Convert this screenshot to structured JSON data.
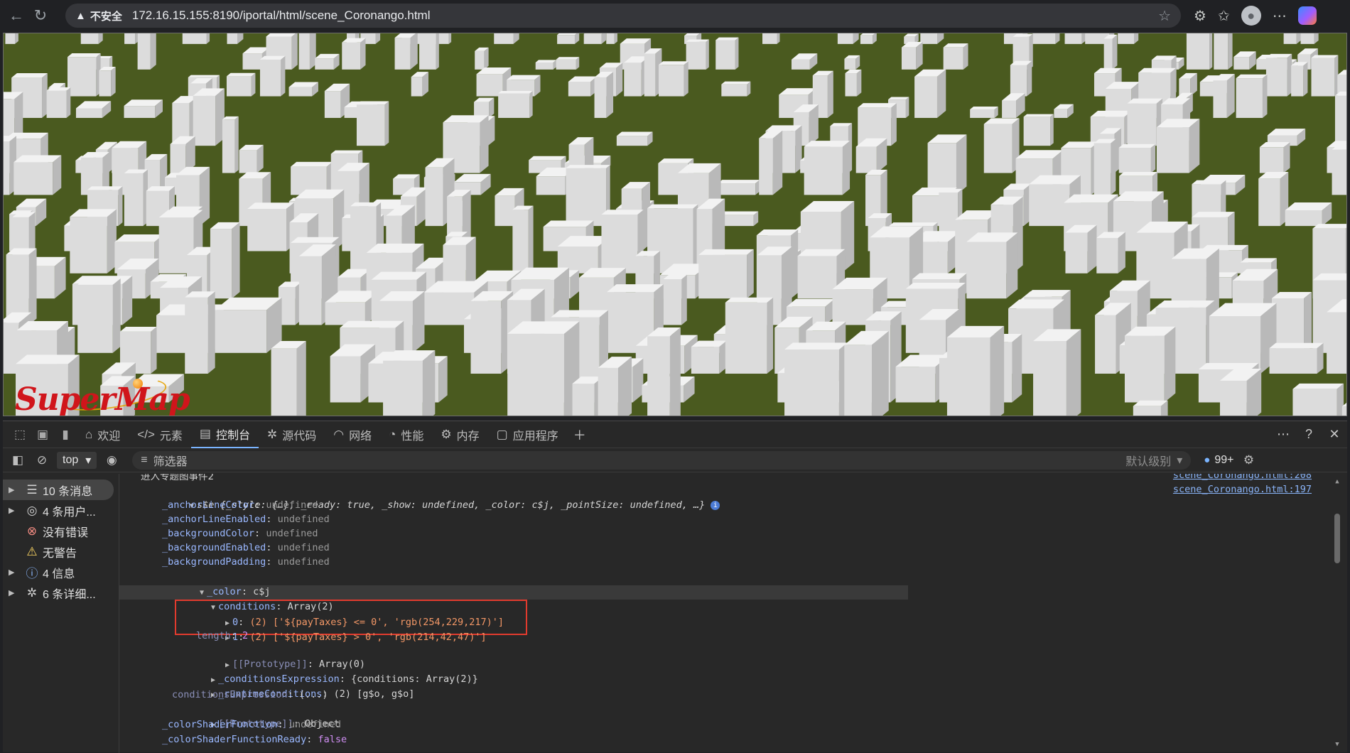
{
  "browser": {
    "security_label": "不安全",
    "url": "172.16.15.155:8190/iportal/html/scene_Coronango.html"
  },
  "scene": {
    "logo_text": "SuperMap",
    "ground_color": "#4a5a1f",
    "building_color": "#e6e6e6"
  },
  "devtools": {
    "tabs": [
      {
        "label": "欢迎",
        "icon": "home-icon"
      },
      {
        "label": "元素",
        "icon": "code-icon"
      },
      {
        "label": "控制台",
        "icon": "console-icon",
        "active": true
      },
      {
        "label": "源代码",
        "icon": "bug-icon"
      },
      {
        "label": "网络",
        "icon": "wifi-icon"
      },
      {
        "label": "性能",
        "icon": "gauge-icon"
      },
      {
        "label": "内存",
        "icon": "memory-icon"
      },
      {
        "label": "应用程序",
        "icon": "app-icon"
      }
    ],
    "toolbar": {
      "context": "top",
      "filter_placeholder": "筛选器",
      "level": "默认级别",
      "issues_count": "99+"
    },
    "sidebar": [
      {
        "label": "10 条消息",
        "icon": "list-icon",
        "expandable": true,
        "selected": true
      },
      {
        "label": "4 条用户...",
        "icon": "user-icon",
        "expandable": true
      },
      {
        "label": "没有错误",
        "icon": "error-icon",
        "expandable": false
      },
      {
        "label": "无警告",
        "icon": "warning-icon",
        "expandable": false
      },
      {
        "label": "4 信息",
        "icon": "info-icon",
        "expandable": true
      },
      {
        "label": "6 条详细...",
        "icon": "bug-icon",
        "expandable": true
      }
    ],
    "console": {
      "top_cut_text": "进入专题图事件2",
      "source_prev": "scene_Coronango.html:208",
      "source_main": "scene_Coronango.html:197",
      "object_head": {
        "name": "s$e",
        "preview": "{_style: {…}, _ready: true, _show: undefined, _color: c$j, _pointSize: undefined, …}"
      },
      "props": [
        {
          "key": "_anchorLineColor",
          "value": "undefined"
        },
        {
          "key": "_anchorLineEnabled",
          "value": "undefined"
        },
        {
          "key": "_backgroundColor",
          "value": "undefined"
        },
        {
          "key": "_backgroundEnabled",
          "value": "undefined"
        },
        {
          "key": "_backgroundPadding",
          "value": "undefined"
        }
      ],
      "color_key": "_color",
      "color_value": "c$j",
      "conditions_key": "conditions",
      "conditions_value": "Array(2)",
      "cond0_index": "0",
      "cond0_text": "(2) ['${payTaxes} <= 0', 'rgb(254,229,217)']",
      "cond1_index": "1",
      "cond1_text": "(2) ['${payTaxes} > 0', 'rgb(214,42,47)']",
      "length_key": "length",
      "length_value": "2",
      "proto_key": "[[Prototype]]",
      "proto_array_value": "Array(0)",
      "cond_expr_key": "_conditionsExpression",
      "cond_expr_value": "{conditions: Array(2)}",
      "runtime_key": "_runtimeConditions",
      "runtime_value": "(2) [g$o, g$o]",
      "cond_expr2_key": "conditionsExpression",
      "cond_expr2_value": "(...)",
      "proto_object_value": "Object",
      "shader_key": "_colorShaderFunction",
      "shader_value": "undefined",
      "shader_ready_key": "_colorShaderFunctionReady",
      "shader_ready_value": "false"
    }
  }
}
